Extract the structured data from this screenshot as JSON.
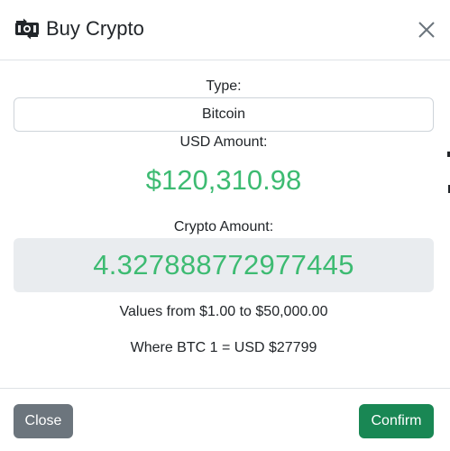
{
  "modal": {
    "title": "Buy Crypto",
    "header_icon": "money-exchange-icon",
    "close_icon": "close-icon"
  },
  "form": {
    "type_label": "Type:",
    "type_value": "Bitcoin",
    "usd_label": "USD Amount:",
    "usd_amount": "$120,310.98",
    "crypto_label": "Crypto Amount:",
    "crypto_amount": "4.327888772977445",
    "range_note": "Values from $1.00 to $50,000.00",
    "rate_note": "Where BTC 1 = USD $27799"
  },
  "footer": {
    "close_label": "Close",
    "confirm_label": "Confirm"
  },
  "colors": {
    "amount_green": "#3dbb72",
    "close_button": "#6c757d",
    "confirm_button": "#198754",
    "readonly_bg": "#e9ecef"
  }
}
